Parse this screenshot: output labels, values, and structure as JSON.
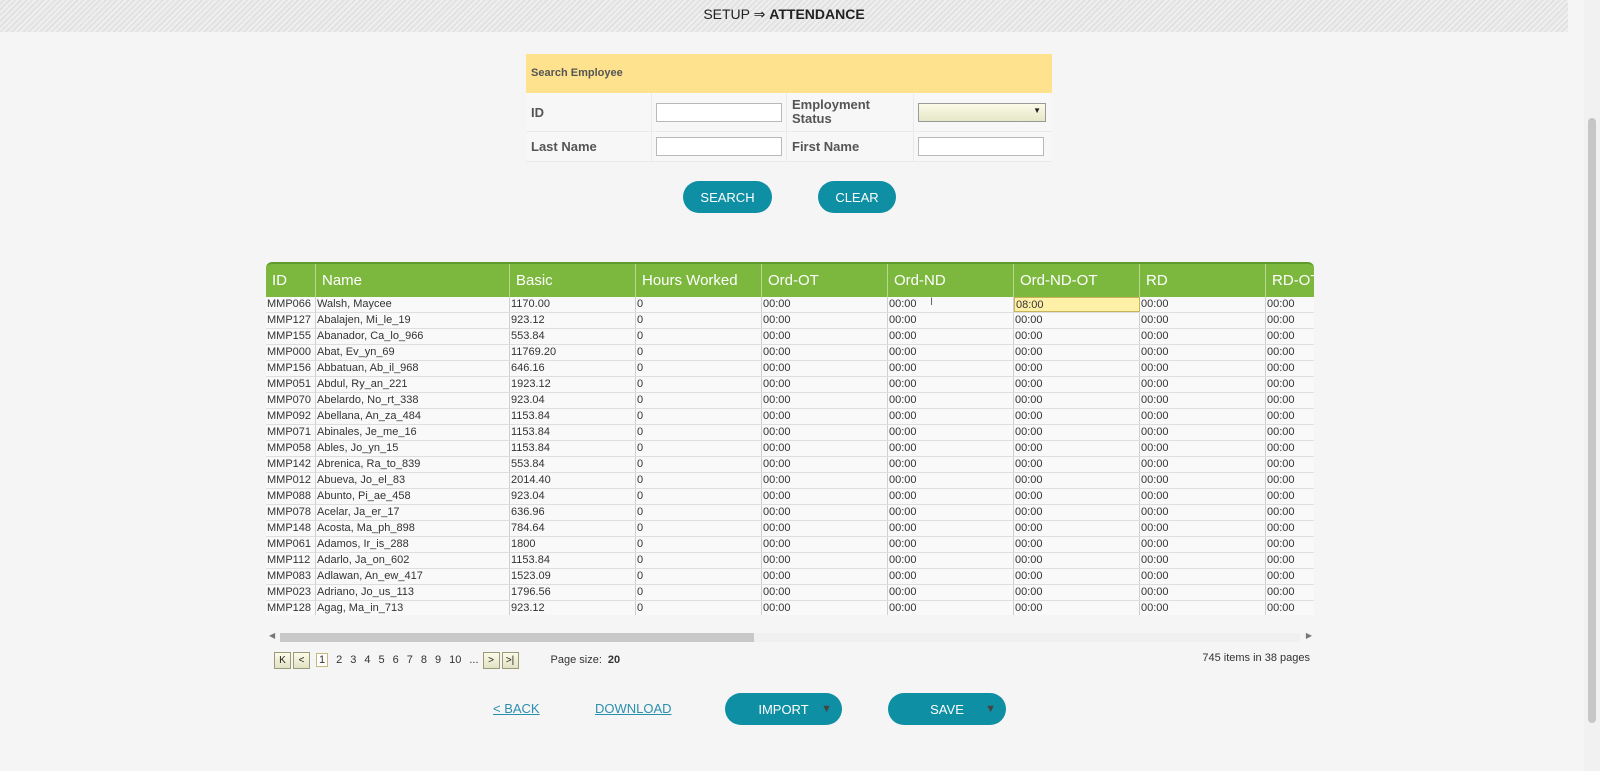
{
  "breadcrumb": {
    "parent": "SETUP",
    "sep": "⇒",
    "current": "ATTENDANCE"
  },
  "search": {
    "header": "Search Employee",
    "id_label": "ID",
    "id_value": "",
    "employment_status_label": "Employment Status",
    "employment_status_value": "",
    "last_name_label": "Last Name",
    "last_name_value": "",
    "first_name_label": "First Name",
    "first_name_value": "",
    "search_button": "SEARCH",
    "clear_button": "CLEAR"
  },
  "grid": {
    "columns": [
      "ID",
      "Name",
      "Basic",
      "Hours Worked",
      "Ord-OT",
      "Ord-ND",
      "Ord-ND-OT",
      "RD",
      "RD-OT"
    ],
    "rows": [
      [
        "MMP066",
        "Walsh, Maycee",
        "1170.00",
        "0",
        "00:00",
        "00:00",
        "08:00",
        "00:00",
        "00:00"
      ],
      [
        "MMP127",
        "Abalajen, Mi_le_19",
        "923.12",
        "0",
        "00:00",
        "00:00",
        "00:00",
        "00:00",
        "00:00"
      ],
      [
        "MMP155",
        "Abanador, Ca_lo_966",
        "553.84",
        "0",
        "00:00",
        "00:00",
        "00:00",
        "00:00",
        "00:00"
      ],
      [
        "MMP000",
        "Abat, Ev_yn_69",
        "11769.20",
        "0",
        "00:00",
        "00:00",
        "00:00",
        "00:00",
        "00:00"
      ],
      [
        "MMP156",
        "Abbatuan, Ab_il_968",
        "646.16",
        "0",
        "00:00",
        "00:00",
        "00:00",
        "00:00",
        "00:00"
      ],
      [
        "MMP051",
        "Abdul, Ry_an_221",
        "1923.12",
        "0",
        "00:00",
        "00:00",
        "00:00",
        "00:00",
        "00:00"
      ],
      [
        "MMP070",
        "Abelardo, No_rt_338",
        "923.04",
        "0",
        "00:00",
        "00:00",
        "00:00",
        "00:00",
        "00:00"
      ],
      [
        "MMP092",
        "Abellana, An_za_484",
        "1153.84",
        "0",
        "00:00",
        "00:00",
        "00:00",
        "00:00",
        "00:00"
      ],
      [
        "MMP071",
        "Abinales, Je_me_16",
        "1153.84",
        "0",
        "00:00",
        "00:00",
        "00:00",
        "00:00",
        "00:00"
      ],
      [
        "MMP058",
        "Ables, Jo_yn_15",
        "1153.84",
        "0",
        "00:00",
        "00:00",
        "00:00",
        "00:00",
        "00:00"
      ],
      [
        "MMP142",
        "Abrenica, Ra_to_839",
        "553.84",
        "0",
        "00:00",
        "00:00",
        "00:00",
        "00:00",
        "00:00"
      ],
      [
        "MMP012",
        "Abueva, Jo_el_83",
        "2014.40",
        "0",
        "00:00",
        "00:00",
        "00:00",
        "00:00",
        "00:00"
      ],
      [
        "MMP088",
        "Abunto, Pi_ae_458",
        "923.04",
        "0",
        "00:00",
        "00:00",
        "00:00",
        "00:00",
        "00:00"
      ],
      [
        "MMP078",
        "Acelar, Ja_er_17",
        "636.96",
        "0",
        "00:00",
        "00:00",
        "00:00",
        "00:00",
        "00:00"
      ],
      [
        "MMP148",
        "Acosta, Ma_ph_898",
        "784.64",
        "0",
        "00:00",
        "00:00",
        "00:00",
        "00:00",
        "00:00"
      ],
      [
        "MMP061",
        "Adamos, Ir_is_288",
        "1800",
        "0",
        "00:00",
        "00:00",
        "00:00",
        "00:00",
        "00:00"
      ],
      [
        "MMP112",
        "Adarlo, Ja_on_602",
        "1153.84",
        "0",
        "00:00",
        "00:00",
        "00:00",
        "00:00",
        "00:00"
      ],
      [
        "MMP083",
        "Adlawan, An_ew_417",
        "1523.09",
        "0",
        "00:00",
        "00:00",
        "00:00",
        "00:00",
        "00:00"
      ],
      [
        "MMP023",
        "Adriano, Jo_us_113",
        "1796.56",
        "0",
        "00:00",
        "00:00",
        "00:00",
        "00:00",
        "00:00"
      ],
      [
        "MMP128",
        "Agag, Ma_in_713",
        "923.12",
        "0",
        "00:00",
        "00:00",
        "00:00",
        "00:00",
        "00:00"
      ]
    ]
  },
  "pager": {
    "pages": [
      "1",
      "2",
      "3",
      "4",
      "5",
      "6",
      "7",
      "8",
      "9",
      "10",
      "..."
    ],
    "current_page": "1",
    "page_size_label": "Page size:",
    "page_size": "20",
    "items_info": "745 items in 38 pages"
  },
  "actions": {
    "back": "< BACK",
    "download": "DOWNLOAD",
    "import": "IMPORT",
    "save": "SAVE"
  },
  "colors": {
    "accent": "#0e8fa3",
    "grid_header": "#7cb83e",
    "search_header": "#ffe28e",
    "highlight_cell": "#fff0a8"
  }
}
